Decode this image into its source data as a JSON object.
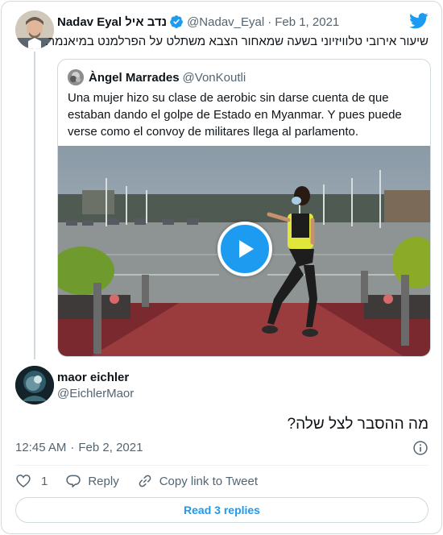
{
  "parent_tweet": {
    "display_name": "Nadav Eyal נדב איל",
    "handle": "@Nadav_Eyal",
    "separator": "·",
    "date": "Feb 1, 2021",
    "text": "שיעור אירובי טלוויזיוני בשעה שמאחור הצבא משתלט על הפרלמנט במיאנמר.",
    "verified": true
  },
  "quoted_tweet": {
    "display_name": "Àngel Marrades",
    "handle": "@VonKoutli",
    "text": "Una mujer hizo su clase de aerobic sin darse cuenta de que estaban dando el golpe de Estado en Myanmar. Y pues puede verse como el convoy de militares llega al parlamento.",
    "media": "video"
  },
  "reply_tweet": {
    "display_name": "maor eichler",
    "handle": "@EichlerMaor",
    "text": "מה ההסבר לצל שלה?",
    "time": "12:45 AM",
    "separator": "·",
    "date": "Feb 2, 2021"
  },
  "actions": {
    "like_count": "1",
    "reply_label": "Reply",
    "copy_link_label": "Copy link to Tweet"
  },
  "read_replies_label": "Read 3 replies",
  "icons": {
    "brand": "twitter-bird-icon",
    "verified": "verified-badge-icon",
    "play": "play-icon",
    "info": "info-icon",
    "like": "heart-icon",
    "reply": "reply-bubble-icon",
    "copy_link": "link-icon"
  },
  "colors": {
    "accent": "#1d9bf0",
    "text_primary": "#0f1419",
    "text_secondary": "#536471",
    "border": "#cfd9de"
  }
}
